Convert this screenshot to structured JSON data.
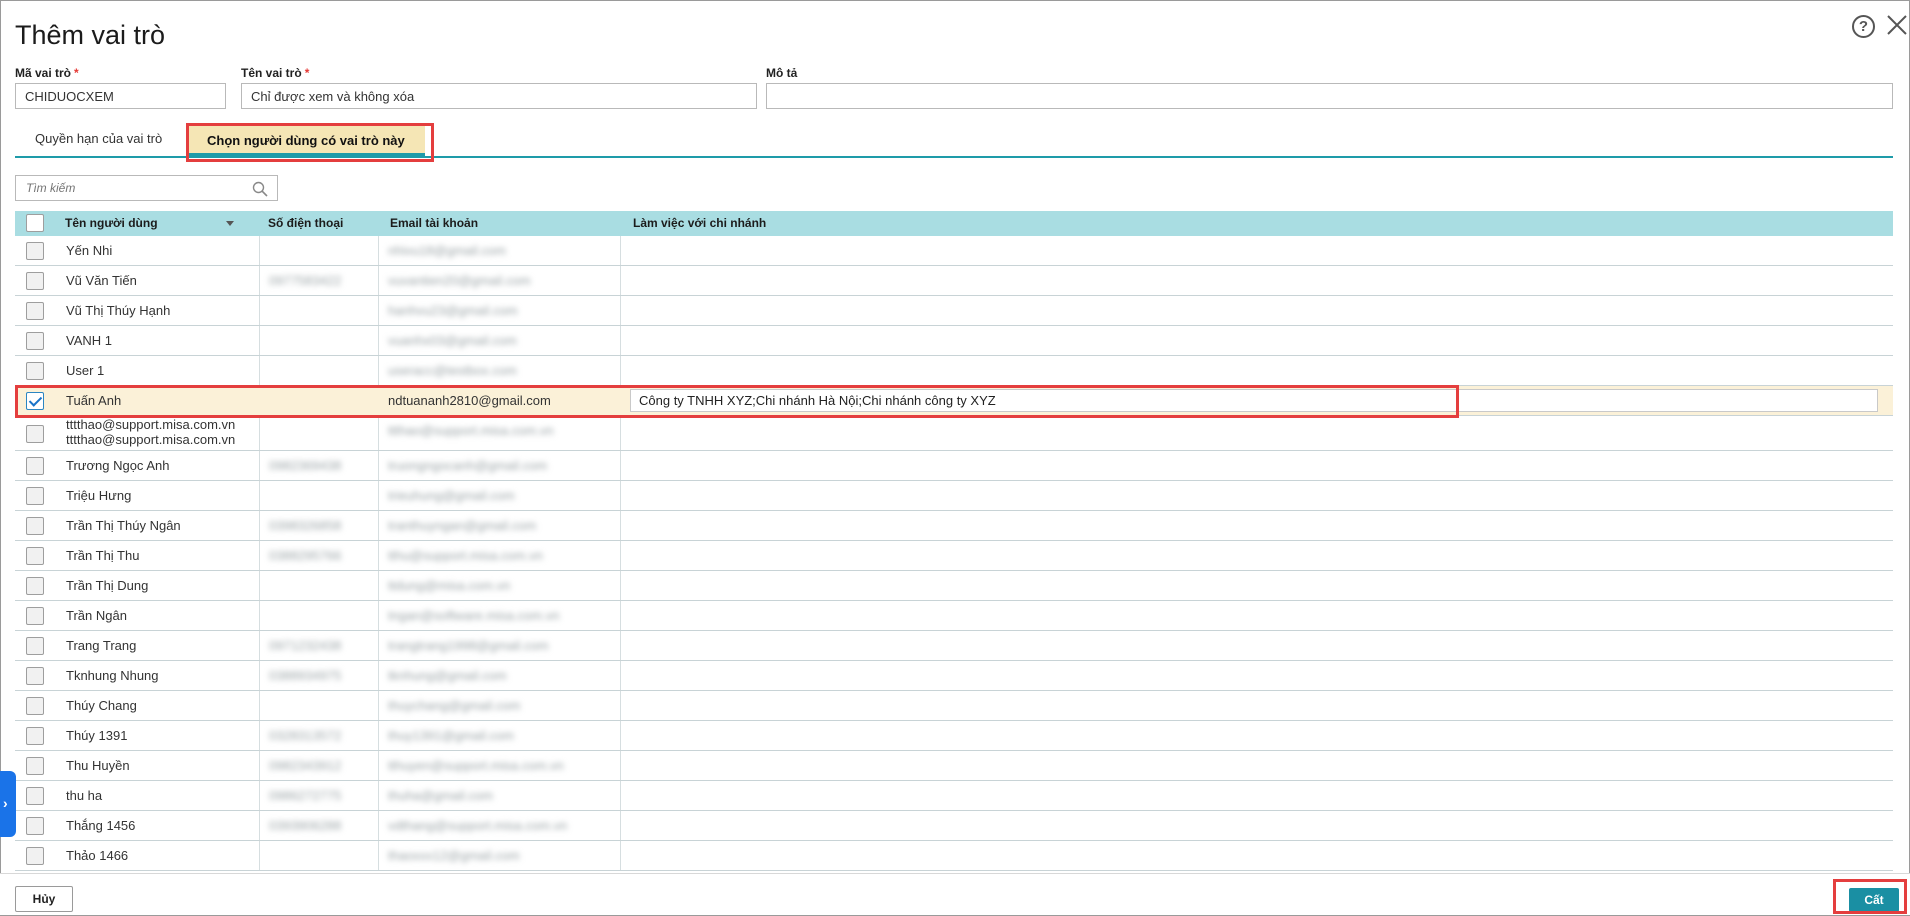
{
  "dialog": {
    "title": "Thêm vai trò",
    "help_icon": "question-circle-icon",
    "close_icon": "close-icon"
  },
  "form": {
    "code_label": "Mã vai trò",
    "code_value": "CHIDUOCXEM",
    "name_label": "Tên vai trò",
    "name_value": "Chỉ được xem và không xóa",
    "desc_label": "Mô tả",
    "desc_value": "",
    "required_mark": "*"
  },
  "tabs": [
    {
      "label": "Quyền hạn của vai trò",
      "active": false
    },
    {
      "label": "Chọn người dùng có vai trò này",
      "active": true
    }
  ],
  "search": {
    "placeholder": "Tìm kiếm",
    "icon": "search-icon"
  },
  "table": {
    "columns": [
      "Tên người dùng",
      "Số điện thoại",
      "Email tài khoản",
      "Làm việc với chi nhánh"
    ],
    "rows": [
      {
        "name": "Yến Nhi",
        "phone": "",
        "email": "nhivu18@gmail.com",
        "branch": "",
        "checked": false
      },
      {
        "name": "Vũ Văn Tiến",
        "phone": "0977583422",
        "email": "vuvantien20@gmail.com",
        "branch": "",
        "checked": false
      },
      {
        "name": "Vũ Thị Thúy Hạnh",
        "phone": "",
        "email": "hanhvu23@gmail.com",
        "branch": "",
        "checked": false
      },
      {
        "name": "VANH 1",
        "phone": "",
        "email": "vuanhx03@gmail.com",
        "branch": "",
        "checked": false
      },
      {
        "name": "User 1",
        "phone": "",
        "email": "useracc@testbox.com",
        "branch": "",
        "checked": false
      },
      {
        "name": "Tuấn Anh",
        "phone": "",
        "email": "ndtuananh2810@gmail.com",
        "branch": "Công ty TNHH XYZ;Chi nhánh Hà Nội;Chi nhánh công ty XYZ",
        "checked": true
      },
      {
        "name": "tttthao@support.misa.com.vn",
        "name2": "tttthao@support.misa.com.vn",
        "phone": "",
        "email": "ttthao@support.misa.com.vn",
        "branch": "",
        "checked": false
      },
      {
        "name": "Trương Ngọc Anh",
        "phone": "0982369438",
        "email": "truongngocanh@gmail.com",
        "branch": "",
        "checked": false
      },
      {
        "name": "Triệu Hưng",
        "phone": "",
        "email": "trieuhung@gmail.com",
        "branch": "",
        "checked": false
      },
      {
        "name": "Trần Thị Thúy Ngân",
        "phone": "0398326858",
        "email": "tranthuyngan@gmail.com",
        "branch": "",
        "checked": false
      },
      {
        "name": "Trần Thị Thu",
        "phone": "0388295766",
        "email": "tthu@support.misa.com.vn",
        "branch": "",
        "checked": false
      },
      {
        "name": "Trần Thị Dung",
        "phone": "",
        "email": "ttdung@misa.com.vn",
        "branch": "",
        "checked": false
      },
      {
        "name": "Trần Ngân",
        "phone": "",
        "email": "tngan@software.misa.com.vn",
        "branch": "",
        "checked": false
      },
      {
        "name": "Trang Trang",
        "phone": "0971232438",
        "email": "trangtrang1998@gmail.com",
        "branch": "",
        "checked": false
      },
      {
        "name": "Tknhung Nhung",
        "phone": "0388934975",
        "email": "tknhung@gmail.com",
        "branch": "",
        "checked": false
      },
      {
        "name": "Thúy Chang",
        "phone": "",
        "email": "thuychang@gmail.com",
        "branch": "",
        "checked": false
      },
      {
        "name": "Thúy 1391",
        "phone": "0328313572",
        "email": "thuy1391@gmail.com",
        "branch": "",
        "checked": false
      },
      {
        "name": "Thu Huyền",
        "phone": "0982343912",
        "email": "tthuyen@support.misa.com.vn",
        "branch": "",
        "checked": false
      },
      {
        "name": "thu ha",
        "phone": "0986272775",
        "email": "thuha@gmail.com",
        "branch": "",
        "checked": false
      },
      {
        "name": "Thắng 1456",
        "phone": "0393906288",
        "email": "vdthang@support.misa.com.vn",
        "branch": "",
        "checked": false
      },
      {
        "name": "Thảo 1466",
        "phone": "",
        "email": "thaoxxx12@gmail.com",
        "branch": "",
        "checked": false
      }
    ]
  },
  "footer": {
    "cancel_label": "Hủy",
    "save_label": "Cất"
  }
}
